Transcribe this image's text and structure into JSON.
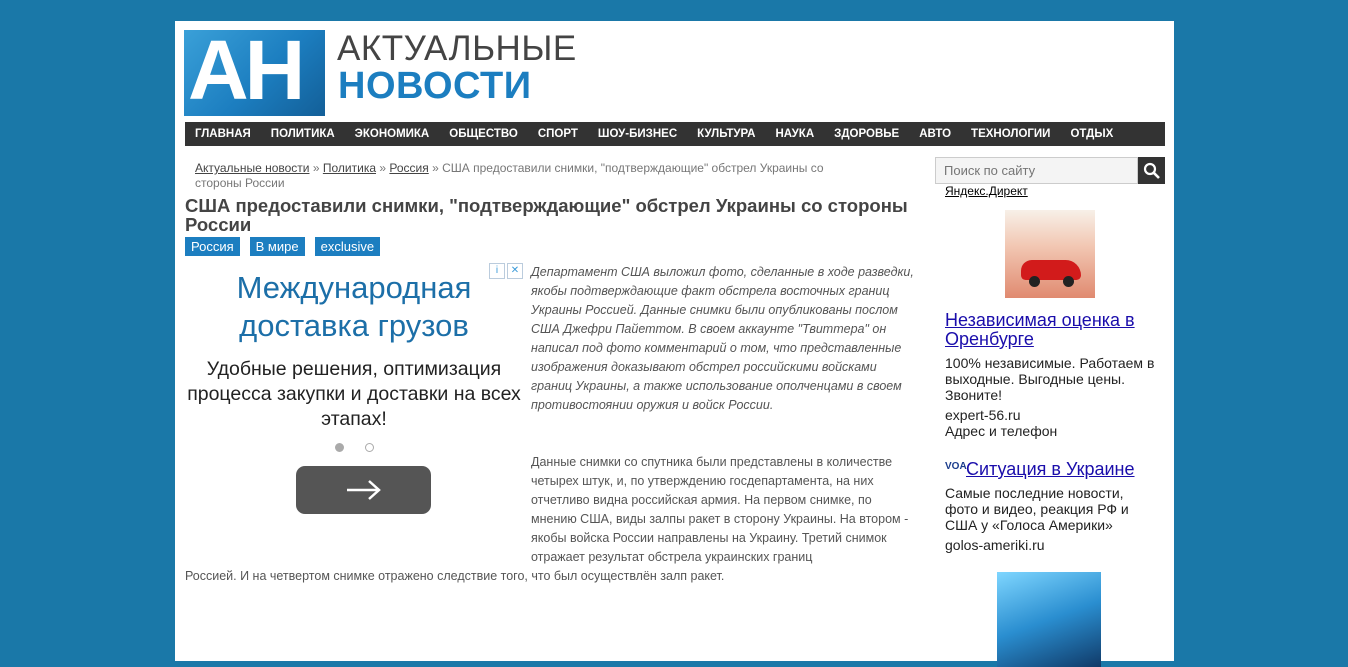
{
  "logo": {
    "letters": "АН",
    "line1": "АКТУАЛЬНЫЕ",
    "line2": "НОВОСТИ"
  },
  "nav": [
    "ГЛАВНАЯ",
    "ПОЛИТИКА",
    "ЭКОНОМИКА",
    "ОБЩЕСТВО",
    "СПОРТ",
    "ШОУ-БИЗНЕС",
    "КУЛЬТУРА",
    "НАУКА",
    "ЗДОРОВЬЕ",
    "АВТО",
    "ТЕХНОЛОГИИ",
    "ОТДЫХ"
  ],
  "breadcrumb": {
    "home": "Актуальные новости",
    "sep": "»",
    "politics": "Политика",
    "russia": "Россия",
    "current": "США предоставили снимки, \"подтверждающие\" обстрел Украины со стороны России"
  },
  "article": {
    "title": "США предоставили снимки, \"подтверждающие\" обстрел Украины со стороны России",
    "tags": [
      "Россия",
      "В мире",
      "exclusive"
    ],
    "lead": "Департамент США выложил фото, сделанные в ходе разведки, якобы подтверждающие факт обстрела восточных границ Украины Россией. Данные снимки были опубликованы послом США Джефри Пайеттом. В своем аккаунте \"Твиттера\" он написал под фото комментарий о том, что представленные изображения доказывают обстрел российскими войсками границ Украины, а также использование ополченцами в своем противостоянии оружия и войск России.",
    "body1": "Данные снимки со спутника были представлены в количестве четырех штук, и, по утверждению госдепартамента, на них отчетливо видна российская армия. На первом снимке, по мнению США, виды залпы ракет в сторону Украины. На втором - якобы войска России направлены на Украину. Третий снимок отражает результат обстрела украинских границ",
    "body2": "Россией. И на четвертом снимке отражено следствие того, что был осуществлён залп ракет."
  },
  "ad_main": {
    "headline": "Международная доставка грузов",
    "subtext": "Удобные решения, оптимизация процесса закупки и доставки на всех этапах!",
    "info_icon": "info-icon",
    "close_icon": "close-icon"
  },
  "sidebar": {
    "search_placeholder": "Поиск по сайту",
    "direct_label": "Яндекс.Директ",
    "ad1": {
      "title": "Независимая оценка в Оренбурге",
      "text": "100% независимые. Работаем в выходные. Выгодные цены. Звоните!",
      "domain": "expert-56.ru",
      "extra": "Адрес и телефон"
    },
    "ad2": {
      "icon_label": "VOA",
      "title": "Ситуация в Украине",
      "text": "Самые последние новости, фото и видео, реакция РФ и США у «Голоса Америки»",
      "domain": "golos-ameriki.ru"
    }
  },
  "colors": {
    "background": "#1a78a8",
    "accent": "#1c7ec0",
    "nav": "#333333"
  }
}
